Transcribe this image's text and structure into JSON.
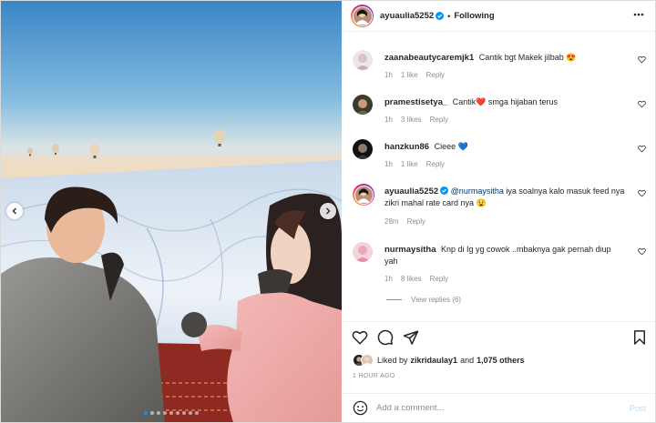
{
  "post": {
    "author": "ayuaulia5252",
    "separator": "•",
    "follow_status": "Following"
  },
  "carousel": {
    "slides_count": 9,
    "active_index": 0
  },
  "comments": [
    {
      "user": "zaanabeautycaremjk1",
      "text": "Cantik bgt Makek jilbab 😍",
      "time": "1h",
      "likes": "1 like",
      "reply": "Reply",
      "verified": false
    },
    {
      "user": "pramestisetya_",
      "text": "Cantik❤️ smga hijaban terus",
      "time": "1h",
      "likes": "3 likes",
      "reply": "Reply",
      "verified": false
    },
    {
      "user": "hanzkun86",
      "text": "Cieee 💙",
      "time": "1h",
      "likes": "1 like",
      "reply": "Reply",
      "verified": false
    },
    {
      "user": "ayuaulia5252",
      "mention": "@nurmaysitha",
      "text": "iya soalnya kalo masuk feed nya zikri mahal rate card nya 😧",
      "time": "28m",
      "reply": "Reply",
      "verified": true
    },
    {
      "user": "nurmaysitha",
      "text": "Knp di Ig yg cowok ..mbaknya gak pernah diup yah",
      "time": "1h",
      "likes": "8 likes",
      "reply": "Reply",
      "verified": false
    }
  ],
  "view_replies": "View replies (6)",
  "likes": {
    "prefix": "Liked by",
    "user": "zikridaulay1",
    "conj": "and",
    "others": "1,075 others"
  },
  "timestamp": "1 HOUR AGO",
  "add_comment": {
    "placeholder": "Add a comment...",
    "post_label": "Post"
  },
  "colors": {
    "verified": "#0095f6",
    "mention": "#00376b",
    "post_disabled": "#b2dffc"
  }
}
